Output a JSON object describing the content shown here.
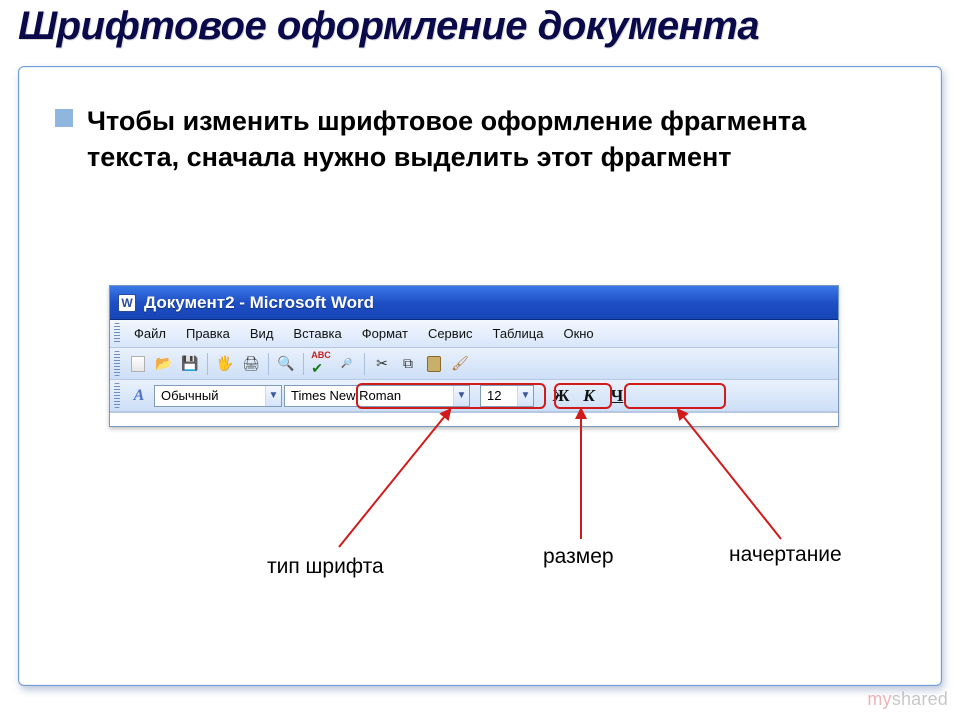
{
  "slide": {
    "title": "Шрифтовое оформление документа",
    "bullet": "Чтобы изменить шрифтовое оформление фрагмента текста, сначала нужно выделить этот фрагмент"
  },
  "word": {
    "title": "Документ2 - Microsoft Word",
    "menu": [
      "Файл",
      "Правка",
      "Вид",
      "Вставка",
      "Формат",
      "Сервис",
      "Таблица",
      "Окно"
    ],
    "style_combo": "Обычный",
    "font_combo": "Times New Roman",
    "size_combo": "12",
    "bold": "Ж",
    "italic": "К",
    "underline": "Ч"
  },
  "annotations": {
    "font_type": "тип шрифта",
    "size": "размер",
    "style_run": "начертание"
  },
  "watermark": "myshared"
}
